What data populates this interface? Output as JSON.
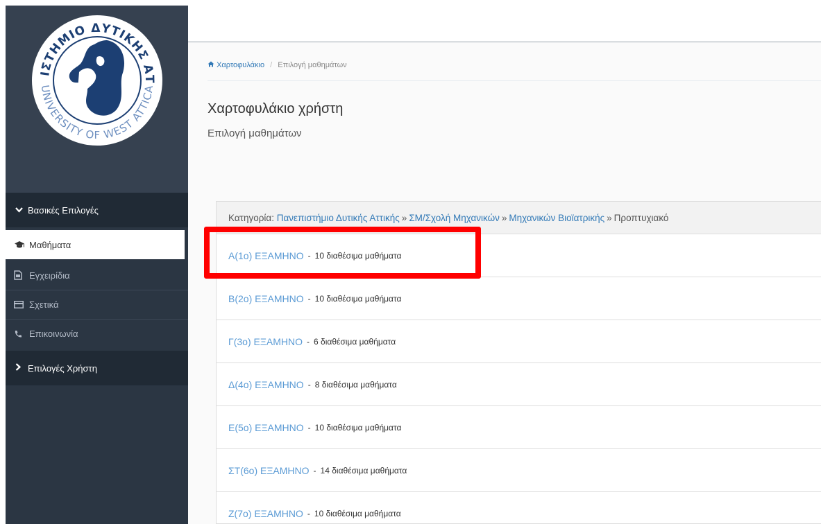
{
  "logo": {
    "top_text": "ΠΑΝΕΠΙΣΤΗΜΙΟ ΔΥΤΙΚΗΣ ΑΤΤΙΚΗΣ",
    "bottom_text": "UNIVERSITY OF WEST ATTICA"
  },
  "sidebar": {
    "main_header": "Βασικές Επιλογές",
    "items": [
      {
        "label": "Μαθήματα",
        "icon": "graduation-cap-icon"
      },
      {
        "label": "Εγχειρίδια",
        "icon": "file-icon"
      },
      {
        "label": "Σχετικά",
        "icon": "credit-card-icon"
      },
      {
        "label": "Επικοινωνία",
        "icon": "phone-icon"
      }
    ],
    "user_header": "Επιλογές Χρήστη"
  },
  "breadcrumb": {
    "home": "Χαρτοφυλάκιο",
    "sep": "/",
    "current": "Επιλογή μαθημάτων"
  },
  "page": {
    "title": "Χαρτοφυλάκιο χρήστη",
    "subtitle": "Επιλογή μαθημάτων"
  },
  "category": {
    "label": "Κατηγορία:",
    "path": [
      "Πανεπιστήμιο Δυτικής Αττικής",
      "ΣΜ/Σχολή Μηχανικών",
      "Μηχανικών Βιοϊατρικής"
    ],
    "sep": "»",
    "current": "Προπτυχιακό"
  },
  "semesters": [
    {
      "name": "Α(1ο) ΕΞΑΜΗΝΟ",
      "dash": "-",
      "count": "10 διαθέσιμα μαθήματα"
    },
    {
      "name": "Β(2ο) ΕΞΑΜΗΝΟ",
      "dash": "-",
      "count": "10 διαθέσιμα μαθήματα"
    },
    {
      "name": "Γ(3ο) ΕΞΑΜΗΝΟ",
      "dash": "-",
      "count": "6 διαθέσιμα μαθήματα"
    },
    {
      "name": "Δ(4ο) ΕΞΑΜΗΝΟ",
      "dash": "-",
      "count": "8 διαθέσιμα μαθήματα"
    },
    {
      "name": "Ε(5ο) ΕΞΑΜΗΝΟ",
      "dash": "-",
      "count": "10 διαθέσιμα μαθήματα"
    },
    {
      "name": "ΣΤ(6ο) ΕΞΑΜΗΝΟ",
      "dash": "-",
      "count": "14 διαθέσιμα μαθήματα"
    },
    {
      "name": "Ζ(7ο) ΕΞΑΜΗΝΟ",
      "dash": "-",
      "count": "10 διαθέσιμα μαθήματα"
    }
  ],
  "colors": {
    "sidebar": "#2b3643",
    "link": "#5b9bd5",
    "highlight": "#ff0000"
  }
}
